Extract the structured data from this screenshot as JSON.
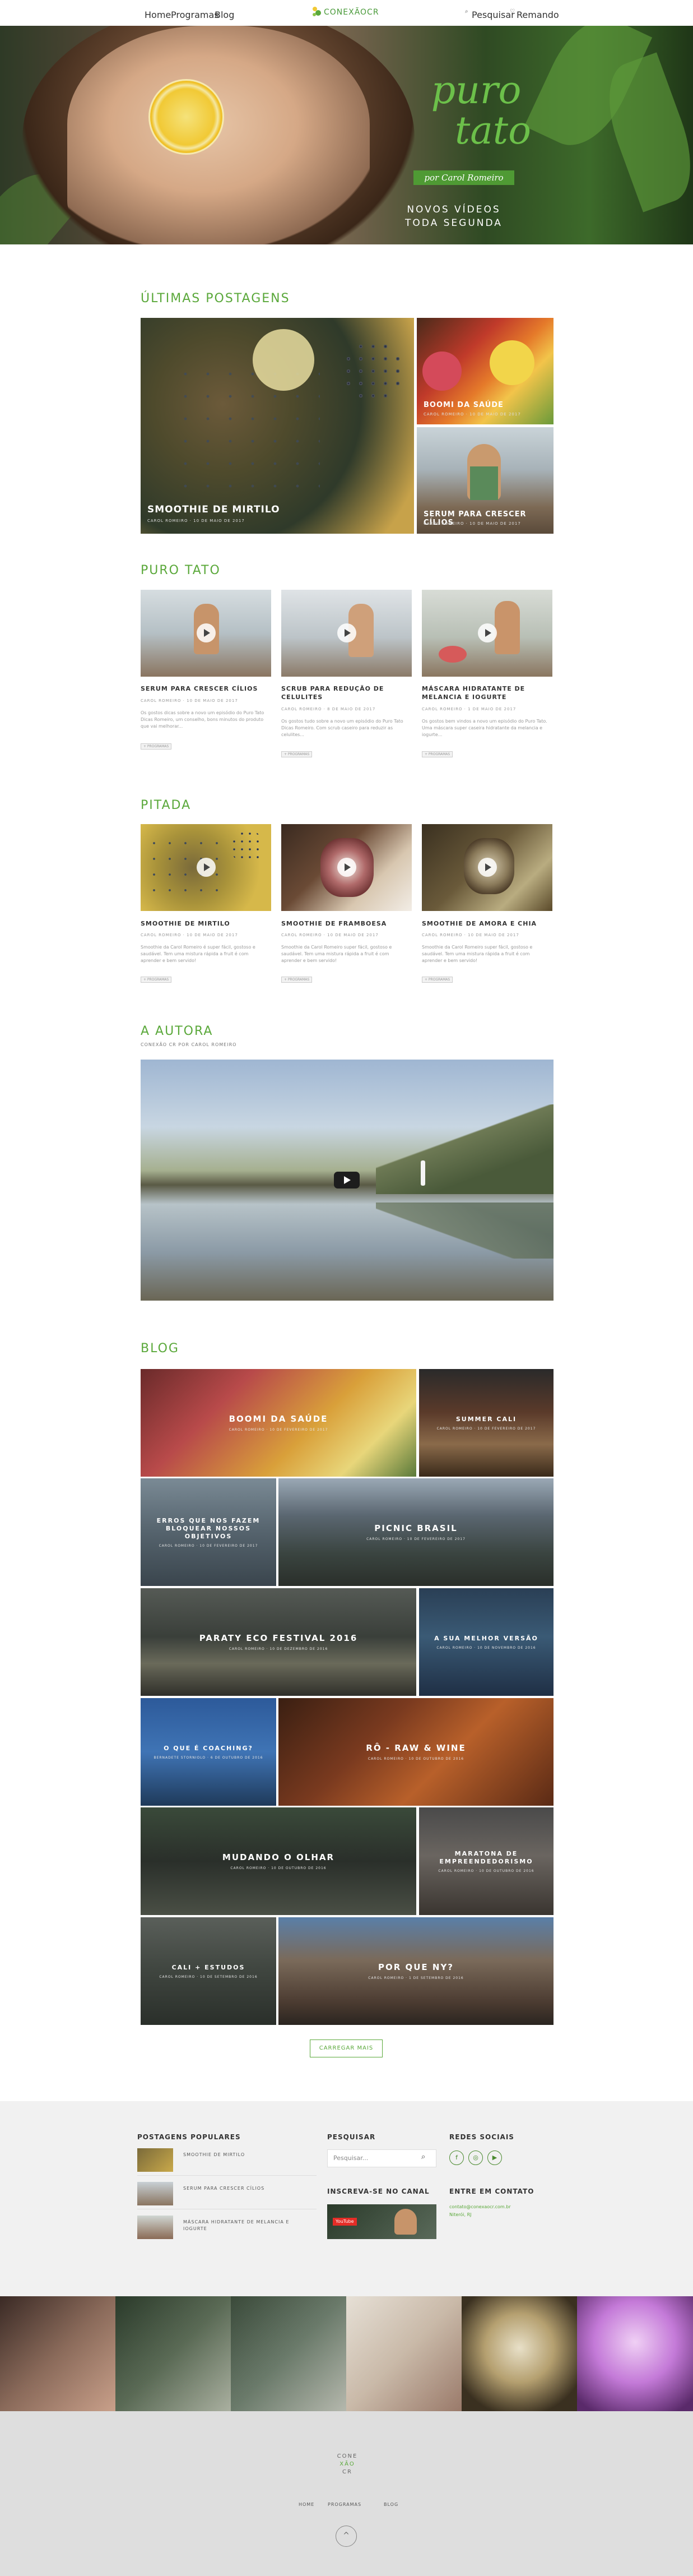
{
  "header": {
    "nav": [
      "Home",
      "Programas",
      "Blog"
    ],
    "logo": "CONEXÃOCR",
    "search_label": "Pesquisar",
    "wishlist_label": "Remando"
  },
  "hero": {
    "title_line1": "puro",
    "title_line2": "tato",
    "byline": "por Carol Romeiro",
    "tagline1": "NOVOS VÍDEOS",
    "tagline2": "TODA SEGUNDA"
  },
  "latest": {
    "title": "ÚLTIMAS POSTAGENS",
    "items": [
      {
        "title": "SMOOTHIE DE MIRTILO",
        "meta": "CAROL ROMEIRO  ·  10 DE MAIO DE 2017"
      },
      {
        "title": "BOOMI DA SAÚDE",
        "meta": "CAROL ROMEIRO  ·  10 DE MAIO DE 2017"
      },
      {
        "title": "SERUM PARA CRESCER CÍLIOS",
        "meta": "CAROL ROMEIRO  ·  10 DE MAIO DE 2017"
      }
    ]
  },
  "puro_tato": {
    "title": "PURO TATO",
    "cards": [
      {
        "title": "SERUM PARA CRESCER CÍLIOS",
        "meta": "CAROL ROMEIRO  ·  10 DE MAIO DE 2017",
        "desc": "Os gostos dicas sobre a novo um episódio do Puro Tato Dicas Romeiro, um conselho, bons minutos do produto que vai melhorar...",
        "tag": "+ Programas"
      },
      {
        "title": "SCRUB PARA REDUÇÃO DE CELULITES",
        "meta": "CAROL ROMEIRO  ·  8 DE MAIO DE 2017",
        "desc": "Os gostos tudo sobre a novo um episódio do Puro Tato Dicas Romeiro. Com scrub caseiro para reduzir as celulites...",
        "tag": "+ Programas"
      },
      {
        "title": "MÁSCARA HIDRATANTE DE MELANCIA E IOGURTE",
        "meta": "CAROL ROMEIRO  ·  1 DE MAIO DE 2017",
        "desc": "Os gostos bem vindos a novo um episódio do Puro Tato. Uma máscara super caseira hidratante da melancia e iogurte...",
        "tag": "+ Programas"
      }
    ]
  },
  "pitada": {
    "title": "PITADA",
    "cards": [
      {
        "title": "SMOOTHIE DE MIRTILO",
        "meta": "CAROL ROMEIRO  ·  10 DE MAIO DE 2017",
        "desc": "Smoothie da Carol Romeiro é super fácil, gostoso e saudável. Tem uma mistura rápida a fruit é com aprender e bem servido!",
        "tag": "+ Programas"
      },
      {
        "title": "SMOOTHIE DE FRAMBOESA",
        "meta": "CAROL ROMEIRO  ·  10 DE MAIO DE 2017",
        "desc": "Smoothie da Carol Romeiro super fácil, gostoso e saudável. Tem uma mistura rápida a fruit é com aprender e bem servido!",
        "tag": "+ Programas"
      },
      {
        "title": "SMOOTHIE DE AMORA E CHIA",
        "meta": "CAROL ROMEIRO  ·  10 DE MAIO DE 2017",
        "desc": "Smoothie da Carol Romeiro super fácil, gostoso e saudável. Tem uma mistura rápida a fruit é com aprender e bem servido!",
        "tag": "+ Programas"
      }
    ]
  },
  "autora": {
    "title": "A AUTORA",
    "subtitle": "CONEXÃO CR POR CAROL ROMEIRO"
  },
  "blog": {
    "title": "BLOG",
    "tiles": [
      {
        "title": "BOOMI DA SAÚDE",
        "meta": "CAROL ROMEIRO  ·  10 DE FEVEREIRO DE 2017"
      },
      {
        "title": "SUMMER CALI",
        "meta": "CAROL ROMEIRO  ·  10 DE FEVEREIRO DE 2017"
      },
      {
        "title": "ERROS QUE NOS FAZEM BLOQUEAR NOSSOS OBJETIVOS",
        "meta": "CAROL ROMEIRO  ·  10 DE FEVEREIRO DE 2017"
      },
      {
        "title": "PICNIC BRASIL",
        "meta": "CAROL ROMEIRO  ·  10 DE FEVEREIRO DE 2017"
      },
      {
        "title": "PARATY ECO FESTIVAL 2016",
        "meta": "CAROL ROMEIRO  ·  10 DE DEZEMBRO DE 2016"
      },
      {
        "title": "A SUA MELHOR VERSÃO",
        "meta": "CAROL ROMEIRO  ·  10 DE NOVEMBRO DE 2016"
      },
      {
        "title": "O QUE É COACHING?",
        "meta": "BERNADETE STORNIOLO  ·  6 DE OUTUBRO DE 2016"
      },
      {
        "title": "RÔ - RAW & WINE",
        "meta": "CAROL ROMEIRO  ·  10 DE OUTUBRO DE 2016"
      },
      {
        "title": "MUDANDO O OLHAR",
        "meta": "CAROL ROMEIRO  ·  10 DE OUTUBRO DE 2016"
      },
      {
        "title": "MARATONA DE EMPREENDEDORISMO",
        "meta": "CAROL ROMEIRO  ·  10 DE OUTUBRO DE 2016"
      },
      {
        "title": "CALI + ESTUDOS",
        "meta": "CAROL ROMEIRO  ·  10 DE SETEMBRO DE 2016"
      },
      {
        "title": "POR QUE NY?",
        "meta": "CAROL ROMEIRO  ·  1 DE SETEMBRO DE 2016"
      }
    ],
    "load_more": "CARREGAR MAIS"
  },
  "footer": {
    "popular_title": "POSTAGENS POPULARES",
    "popular": [
      "SMOOTHIE DE MIRTILO",
      "SERUM PARA CRESCER CÍLIOS",
      "MÁSCARA HIDRATANTE DE MELANCIA E IOGURTE"
    ],
    "search_title": "PESQUISAR",
    "search_placeholder": "Pesquisar...",
    "subscribe_title": "INSCREVA-SE NO CANAL",
    "social_title": "REDES SOCIAIS",
    "contact_title": "ENTRE EM CONTATO",
    "contact_email": "contato@conexaocr.com.br",
    "contact_city": "Niterói, RJ",
    "youtube_label": "YouTube",
    "logo_lines": [
      "CONE",
      "XÃO",
      "CR"
    ],
    "bottom_nav": [
      "HOME",
      "PROGRAMAS",
      "BLOG"
    ]
  },
  "colors": {
    "accent": "#5aa83a"
  }
}
